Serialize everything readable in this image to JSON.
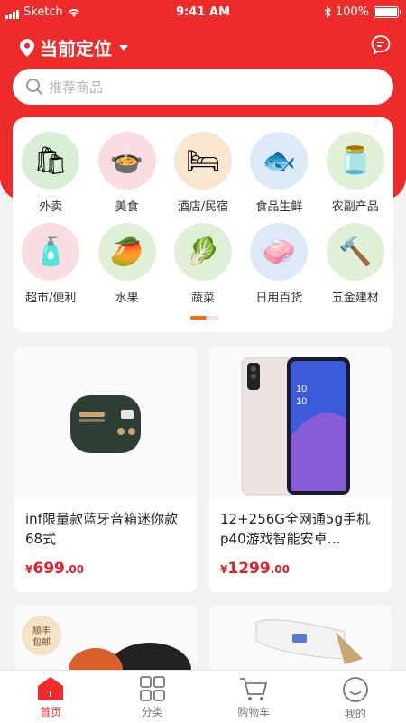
{
  "status": {
    "carrier": "Sketch",
    "time": "9:41 AM",
    "battery": "100%"
  },
  "header": {
    "location_label": "当前定位",
    "search_placeholder": "推荐商品"
  },
  "categories": [
    {
      "label": "外卖",
      "icon": "takeout-bag-icon",
      "bg": "#d9efd5"
    },
    {
      "label": "美食",
      "icon": "food-dish-icon",
      "bg": "#f9dde0"
    },
    {
      "label": "酒店/民宿",
      "icon": "hotel-bed-icon",
      "bg": "#f8e6cf"
    },
    {
      "label": "食品生鲜",
      "icon": "fresh-fish-icon",
      "bg": "#dde9f6"
    },
    {
      "label": "农副产品",
      "icon": "oil-bottle-icon",
      "bg": "#dff0d6"
    },
    {
      "label": "超市/便利",
      "icon": "supermarket-goods-icon",
      "bg": "#f9dde0"
    },
    {
      "label": "水果",
      "icon": "fruit-icon",
      "bg": "#dff0d6"
    },
    {
      "label": "蔬菜",
      "icon": "vegetable-icon",
      "bg": "#dff0d6"
    },
    {
      "label": "日用百货",
      "icon": "daily-goods-icon",
      "bg": "#dde9f6"
    },
    {
      "label": "五金建材",
      "icon": "hardware-tools-icon",
      "bg": "#dff0d6"
    }
  ],
  "products": [
    {
      "title": "inf限量款蓝牙音箱迷你款68式",
      "currency": "¥",
      "price_int": "699",
      "price_dec": ".00",
      "image": "bluetooth-speaker-image"
    },
    {
      "title": "12+256G全网通5g手机p40游戏智能安卓…",
      "currency": "¥",
      "price_int": "1299",
      "price_dec": ".00",
      "image": "smartphone-image"
    },
    {
      "badge": "顺丰包邮",
      "image": "pot-image"
    },
    {
      "image": "grooming-device-image"
    }
  ],
  "tabs": [
    {
      "label": "首页",
      "icon": "home-icon",
      "active": true
    },
    {
      "label": "分类",
      "icon": "category-grid-icon",
      "active": false
    },
    {
      "label": "购物车",
      "icon": "cart-icon",
      "active": false
    },
    {
      "label": "我的",
      "icon": "profile-smile-icon",
      "active": false
    }
  ],
  "colors": {
    "primary": "#ee2b2b",
    "price": "#e0202b",
    "indicator": "#f26a1b"
  }
}
